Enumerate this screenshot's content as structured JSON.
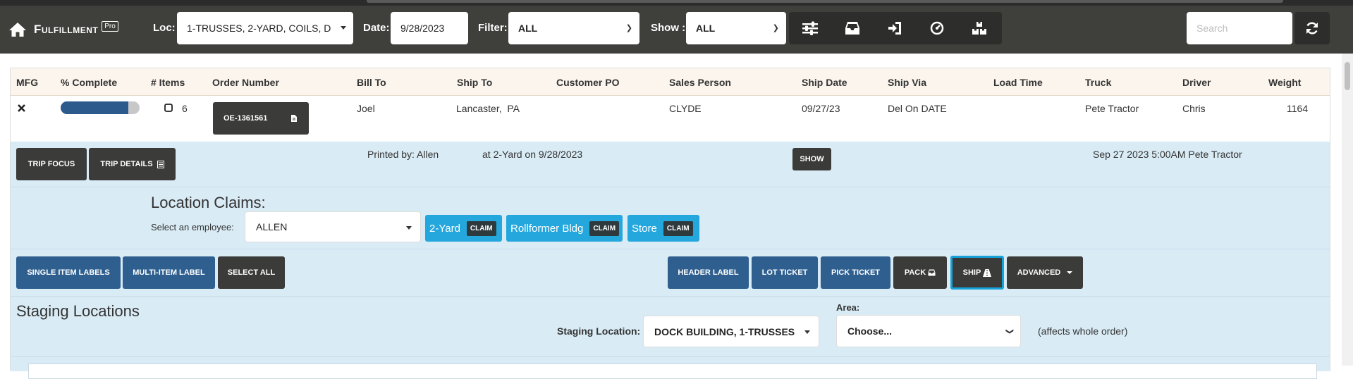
{
  "navbar": {
    "title": "Fulfillment",
    "pro_badge": "Pro",
    "loc_label": "Loc:",
    "loc_value": "1-TRUSSES, 2-YARD, COILS, D",
    "date_label": "Date:",
    "date_value": "9/28/2023",
    "filter_label": "Filter:",
    "filter_value": "ALL",
    "show_label": "Show :",
    "show_value": "ALL",
    "icons": [
      "sliders-icon",
      "inbox-icon",
      "sign-in-icon",
      "dashboard-icon",
      "boxes-icon"
    ],
    "search_placeholder": "Search"
  },
  "table": {
    "headers": [
      "MFG",
      "% Complete",
      "# Items",
      "Order Number",
      "Bill To",
      "Ship To",
      "Customer PO",
      "Sales Person",
      "Ship Date",
      "Ship Via",
      "Load Time",
      "Truck",
      "Driver",
      "Weight"
    ],
    "row": {
      "mfg_icon": "close-icon",
      "percent_complete": 0.86,
      "items": "6",
      "order_number": "OE-1361561",
      "bill_to": "Joel",
      "ship_to": "Lancaster,  PA",
      "customer_po": "",
      "sales_person": "CLYDE",
      "ship_date": "09/27/23",
      "ship_via": "Del On DATE",
      "load_time": "",
      "truck": "Pete Tractor",
      "driver": "Chris",
      "weight": "1164"
    }
  },
  "trip": {
    "trip_focus": "TRIP FOCUS",
    "trip_details": "TRIP DETAILS",
    "printed_by": "Printed by: Allen",
    "printed_at": "at 2-Yard on 9/28/2023",
    "show_button": "SHOW",
    "schedule": "Sep 27 2023 5:00AM Pete Tractor"
  },
  "claims": {
    "title": "Location Claims:",
    "select_label": "Select an employee:",
    "employee": "ALLEN",
    "locations": [
      {
        "name": "2-Yard",
        "action": "CLAIM"
      },
      {
        "name": "Rollformer Bldg",
        "action": "CLAIM"
      },
      {
        "name": "Store",
        "action": "CLAIM"
      }
    ]
  },
  "actions": {
    "single_item_labels": "SINGLE ITEM LABELS",
    "multi_item_label": "MULTI-ITEM LABEL",
    "select_all": "SELECT ALL",
    "header_label": "HEADER LABEL",
    "lot_ticket": "LOT TICKET",
    "pick_ticket": "PICK TICKET",
    "pack": "PACK",
    "ship": "SHIP",
    "advanced": "ADVANCED"
  },
  "staging": {
    "title": "Staging Locations",
    "location_label": "Staging Location:",
    "location_value": "DOCK BUILDING, 1-TRUSSES",
    "area_label": "Area:",
    "area_value": "Choose...",
    "note": "(affects whole order)"
  },
  "colors": {
    "navbar": "#3f3f3c",
    "accent_blue": "#24a7dc",
    "primary_blue": "#2e5f8f",
    "panel_blue": "#d9ebf5",
    "dark_button": "#3b3b39"
  }
}
